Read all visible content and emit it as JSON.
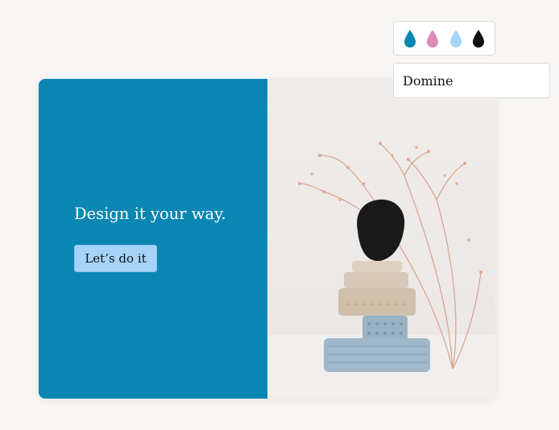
{
  "hero": {
    "tagline": "Design it your way.",
    "cta_label": "Let’s do it",
    "panel_color": "#0a86b3",
    "cta_color": "#a7d3f8"
  },
  "color_swatches": [
    {
      "name": "teal-drop-icon",
      "color": "#0a86b3"
    },
    {
      "name": "pink-drop-icon",
      "color": "#e08bb7"
    },
    {
      "name": "light-blue-drop-icon",
      "color": "#a7d3f8"
    },
    {
      "name": "black-drop-icon",
      "color": "#111111"
    }
  ],
  "font_picker": {
    "value": "Domine"
  },
  "photo": {
    "subject": "stacked-clay-sculpture-with-dried-flowers"
  }
}
